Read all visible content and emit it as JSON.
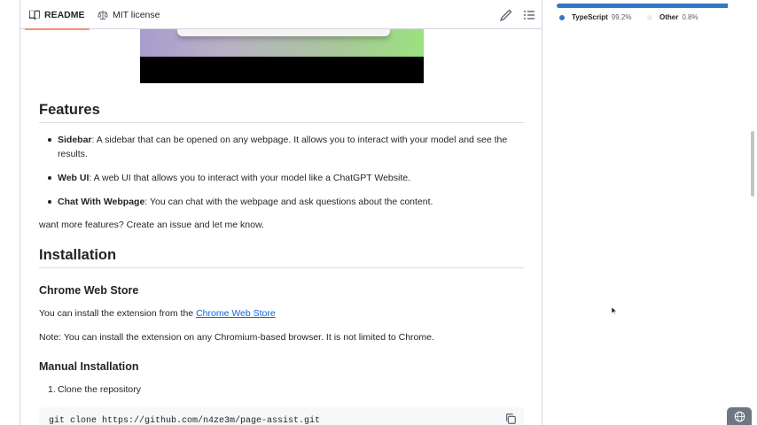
{
  "tabs": {
    "readme_label": "README",
    "license_label": "MIT license"
  },
  "features": {
    "heading": "Features",
    "items": [
      {
        "title": "Sidebar",
        "text": ": A sidebar that can be opened on any webpage. It allows you to interact with your model and see the results."
      },
      {
        "title": "Web UI",
        "text": ": A web UI that allows you to interact with your model like a ChatGPT Website."
      },
      {
        "title": "Chat With Webpage",
        "text": ": You can chat with the webpage and ask questions about the content."
      }
    ],
    "footer": "want more features? Create an issue and let me know."
  },
  "installation": {
    "heading": "Installation",
    "chrome_heading": "Chrome Web Store",
    "chrome_text_prefix": "You can install the extension from the ",
    "chrome_link": "Chrome Web Store",
    "note": "Note: You can install the extension on any Chromium-based browser. It is not limited to Chrome.",
    "manual_heading": "Manual Installation",
    "step1": "Clone the repository",
    "step1_number": "1.",
    "clone_command": "git clone https://github.com/n4ze3m/page-assist.git"
  },
  "languages": [
    {
      "name": "TypeScript",
      "percent": "99.2%",
      "color": "#3178c6",
      "share": 99.2
    },
    {
      "name": "Other",
      "percent": "0.8%",
      "color": "#ededed",
      "share": 0.8
    }
  ],
  "icons": {
    "readme": "book-icon",
    "license": "scale-icon",
    "edit": "pencil-icon",
    "toc": "list-icon",
    "copy": "copy-icon",
    "floating": "globe-icon"
  }
}
